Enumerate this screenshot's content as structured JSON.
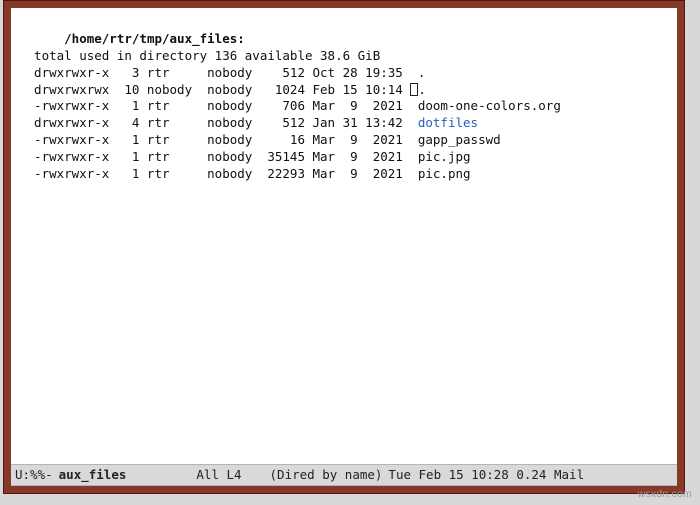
{
  "header": {
    "path": "/home/rtr/tmp/aux_files:",
    "summary": "  total used in directory 136 available 38.6 GiB"
  },
  "rows": [
    {
      "perm": "drwxrwxr-x",
      "n": " 3",
      "owner": "rtr   ",
      "group": "nobody",
      "size": "   512",
      "date": "Oct 28 19:35",
      "cursor": false,
      "name": ".",
      "kind": "plain"
    },
    {
      "perm": "drwxrwxrwx",
      "n": "10",
      "owner": "nobody",
      "group": "nobody",
      "size": "  1024",
      "date": "Feb 15 10:14",
      "cursor": true,
      "name": ".",
      "kind": "plain"
    },
    {
      "perm": "-rwxrwxr-x",
      "n": " 1",
      "owner": "rtr   ",
      "group": "nobody",
      "size": "   706",
      "date": "Mar  9  2021",
      "cursor": false,
      "name": "doom-one-colors.org",
      "kind": "plain"
    },
    {
      "perm": "drwxrwxr-x",
      "n": " 4",
      "owner": "rtr   ",
      "group": "nobody",
      "size": "   512",
      "date": "Jan 31 13:42",
      "cursor": false,
      "name": "dotfiles",
      "kind": "dir"
    },
    {
      "perm": "-rwxrwxr-x",
      "n": " 1",
      "owner": "rtr   ",
      "group": "nobody",
      "size": "    16",
      "date": "Mar  9  2021",
      "cursor": false,
      "name": "gapp_passwd",
      "kind": "plain"
    },
    {
      "perm": "-rwxrwxr-x",
      "n": " 1",
      "owner": "rtr   ",
      "group": "nobody",
      "size": " 35145",
      "date": "Mar  9  2021",
      "cursor": false,
      "name": "pic.jpg",
      "kind": "plain"
    },
    {
      "perm": "-rwxrwxr-x",
      "n": " 1",
      "owner": "rtr   ",
      "group": "nobody",
      "size": " 22293",
      "date": "Mar  9  2021",
      "cursor": false,
      "name": "pic.png",
      "kind": "plain"
    }
  ],
  "modeline": {
    "left": "U:%%-",
    "buffer": "aux_files",
    "pos": "All L4",
    "mode": "(Dired by name)",
    "right": "Tue Feb 15 10:28 0.24 Mail"
  },
  "watermark": "wsxdn.com"
}
